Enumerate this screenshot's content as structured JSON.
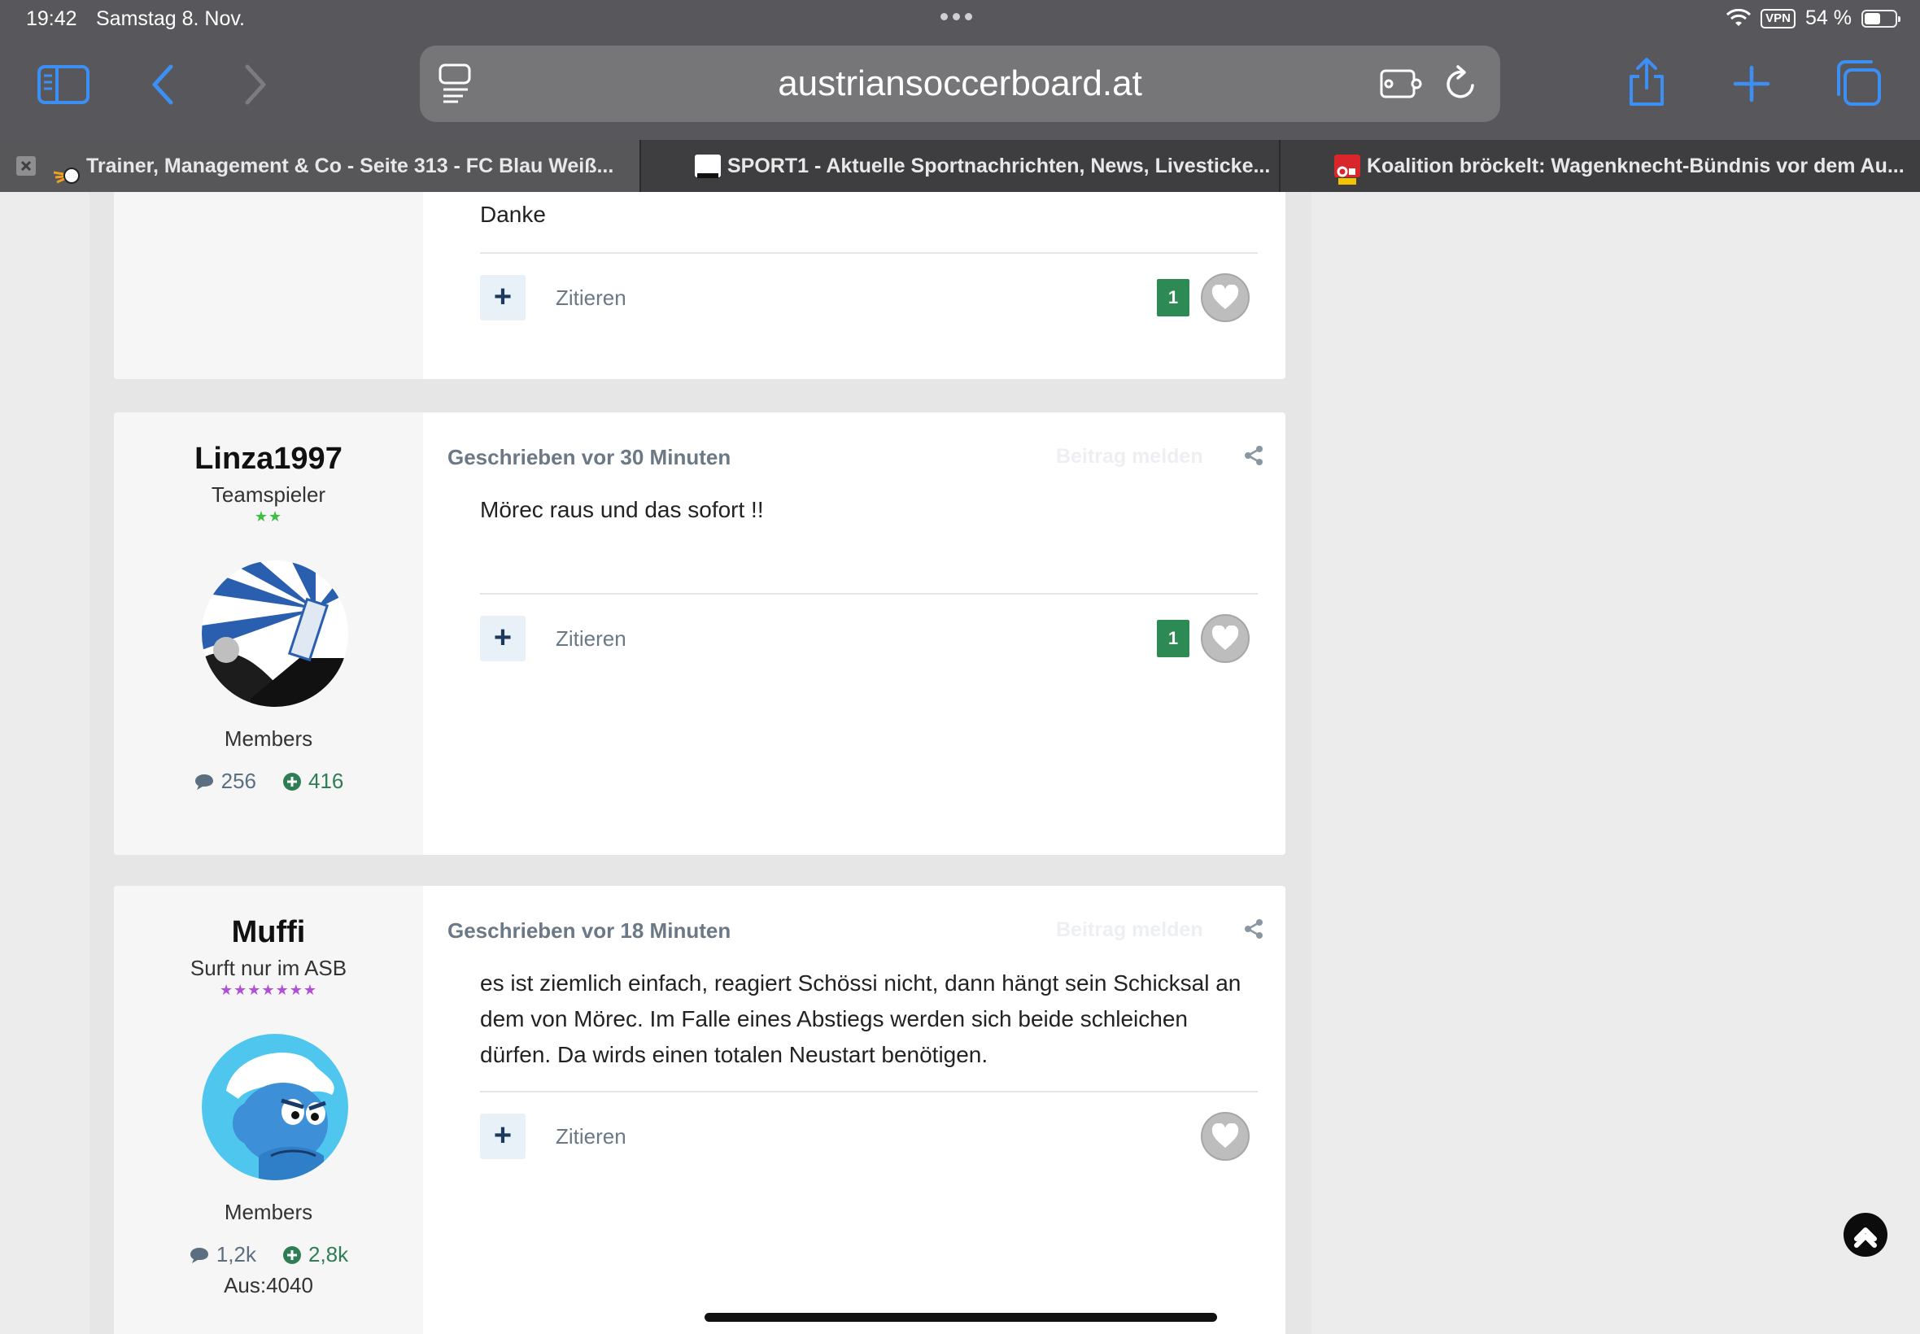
{
  "status": {
    "time": "19:42",
    "date": "Samstag 8. Nov.",
    "vpn": "VPN",
    "battery_text": "54 %",
    "battery_level": 0.54
  },
  "toolbar": {
    "url": "austriansoccerboard.at",
    "icons": [
      "sidebar-icon",
      "back-icon",
      "forward-icon",
      "reader-icon",
      "extension-icon",
      "reload-icon",
      "share-icon",
      "new-tab-icon",
      "tabs-icon"
    ]
  },
  "tabs": [
    {
      "title": "Trainer, Management & Co - Seite 313 - FC Blau Weiß...",
      "active": true,
      "favicon": "asb-favicon"
    },
    {
      "title": "SPORT1 - Aktuelle Sportnachrichten, News, Livesticke...",
      "active": false,
      "favicon": "sport1-favicon"
    },
    {
      "title": "Koalition bröckelt: Wagenknecht-Bündnis vor dem Au...",
      "active": false,
      "favicon": "oe24-favicon"
    }
  ],
  "posts": [
    {
      "body": "Danke",
      "quote_label": "Zitieren",
      "plus_label": "+",
      "like_count": "1"
    },
    {
      "author": "Linza1997",
      "rank": "Teamspieler",
      "stars": "★★",
      "star_color": "#3fbf3f",
      "group": "Members",
      "posts_count": "256",
      "reputation": "416",
      "meta": "Geschrieben vor 30 Minuten",
      "report_label": "Beitrag melden",
      "body": "Mörec raus und das sofort !!",
      "quote_label": "Zitieren",
      "plus_label": "+",
      "like_count": "1"
    },
    {
      "author": "Muffi",
      "rank": "Surft nur im ASB",
      "stars": "★★★★★★★",
      "star_color": "#b04fd8",
      "group": "Members",
      "posts_count": "1,2k",
      "reputation": "2,8k",
      "extra": "Aus:4040",
      "meta": "Geschrieben vor 18 Minuten",
      "report_label": "Beitrag melden",
      "body": "es ist ziemlich einfach, reagiert Schössi nicht, dann hängt sein Schicksal an dem von Mörec. Im Falle eines Abstiegs werden sich beide schleichen dürfen. Da wirds einen totalen Neustart benötigen.",
      "quote_label": "Zitieren",
      "plus_label": "+"
    }
  ],
  "colors": {
    "chrome": "#58585c",
    "accent_blue": "#2f8bff",
    "like_green": "#2e8a55"
  }
}
